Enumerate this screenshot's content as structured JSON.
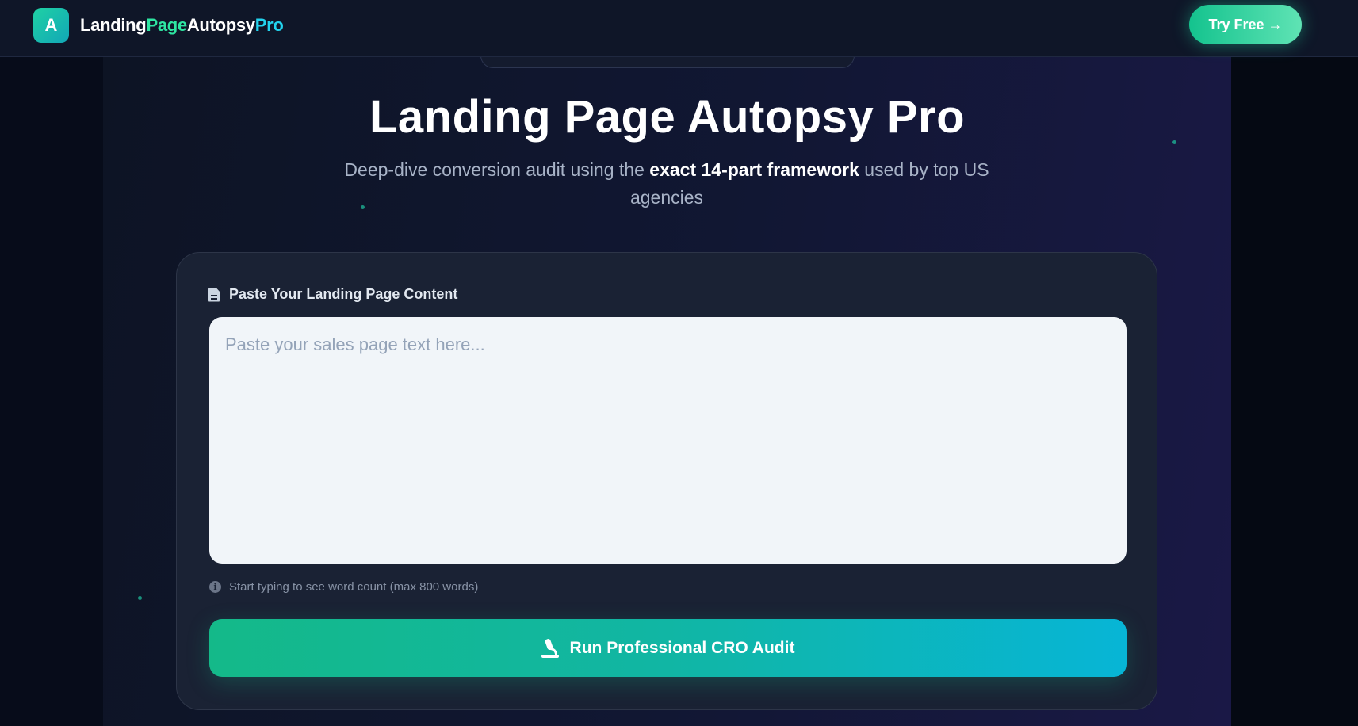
{
  "header": {
    "logo_letter": "A",
    "brand_part1": "Landing",
    "brand_part2": "Page",
    "brand_part3": "Autopsy",
    "brand_part4": "Pro",
    "cta_label": "Try Free →"
  },
  "hero": {
    "title": "Landing Page Autopsy Pro",
    "subtitle_before": "Deep-dive conversion audit using the ",
    "subtitle_bold": "exact 14-part framework",
    "subtitle_after": " used by top US agencies"
  },
  "form": {
    "label": "Paste Your Landing Page Content",
    "textarea_value": "",
    "textarea_placeholder": "Paste your sales page text here...",
    "hint_text": "Start typing to see word count (max 800 words)",
    "submit_label": "Run Professional CRO Audit"
  },
  "colors": {
    "accent_green": "#14b989",
    "accent_cyan": "#07b5d6",
    "brand_green": "#2ee6a2",
    "brand_cyan": "#22d3ee",
    "background": "#0a0f1c",
    "card": "#1a2234"
  },
  "icons": {
    "logo": "letter-a-badge",
    "form_label": "document-icon",
    "hint": "info-icon",
    "submit": "microscope-icon"
  }
}
